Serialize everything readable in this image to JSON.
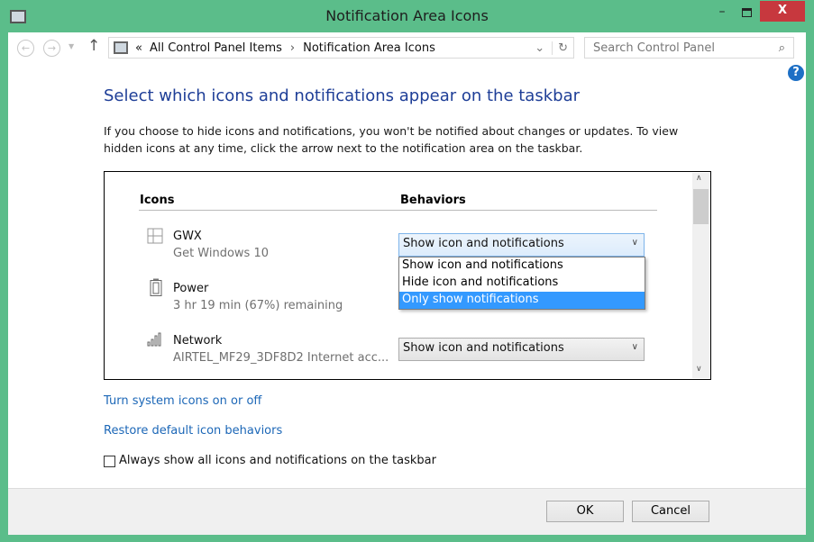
{
  "window": {
    "title": "Notification Area Icons",
    "minimize": "–",
    "close": "X"
  },
  "nav": {
    "back": "←",
    "forward": "→",
    "up": "↑",
    "breadcrumb_sep": "«",
    "path": [
      "All Control Panel Items",
      "Notification Area Icons"
    ],
    "path_arrow": "›",
    "dropdown": "⌄",
    "refresh": "↻"
  },
  "search": {
    "placeholder": "Search Control Panel",
    "icon": "⌕"
  },
  "help": "?",
  "main": {
    "heading": "Select which icons and notifications appear on the taskbar",
    "description": "If you choose to hide icons and notifications, you won't be notified about changes or updates. To view hidden icons at any time, click the arrow next to the notification area on the taskbar.",
    "col_icons": "Icons",
    "col_behaviors": "Behaviors",
    "rows": [
      {
        "name": "GWX",
        "sub": "Get Windows 10",
        "icon": "windows-icon",
        "behavior": "Show icon and notifications"
      },
      {
        "name": "Power",
        "sub": "3 hr 19 min (67%) remaining",
        "icon": "battery-icon"
      },
      {
        "name": "Network",
        "sub": "AIRTEL_MF29_3DF8D2 Internet acc...",
        "icon": "signal-icon",
        "behavior": "Show icon and notifications"
      }
    ],
    "dropdown_options": [
      "Show icon and notifications",
      "Hide icon and notifications",
      "Only show notifications"
    ],
    "dropdown_highlighted": "Only show notifications",
    "link_system_icons": "Turn system icons on or off",
    "link_restore": "Restore default icon behaviors",
    "always_show_label": "Always show all icons and notifications on the taskbar",
    "always_show_checked": false
  },
  "footer": {
    "ok": "OK",
    "cancel": "Cancel"
  }
}
